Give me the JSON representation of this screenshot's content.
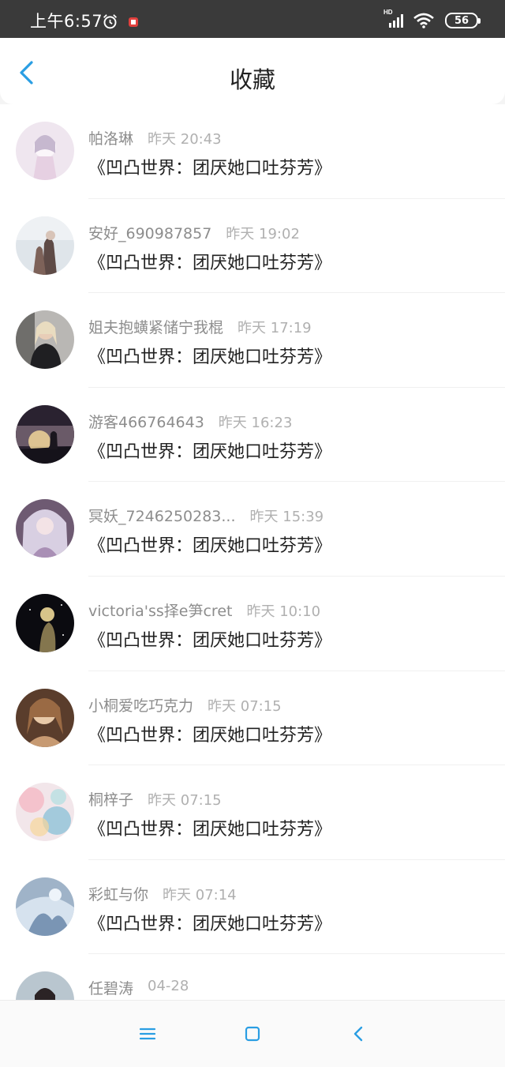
{
  "status_bar": {
    "time": "上午6:57",
    "network": "HD",
    "battery": "56",
    "icons": [
      "alarm-icon",
      "app-notification-icon",
      "signal-icon",
      "wifi-icon",
      "battery-icon"
    ]
  },
  "header": {
    "title": "收藏",
    "back_icon": "chevron-left-icon"
  },
  "favorites": [
    {
      "name": "帕洛琳",
      "time": "昨天 20:43",
      "content": "《凹凸世界：团厌她口吐芬芳》"
    },
    {
      "name": "安好_690987857",
      "time": "昨天 19:02",
      "content": "《凹凸世界：团厌她口吐芬芳》"
    },
    {
      "name": "姐夫抱蟥紧储宁我棍",
      "time": "昨天 17:19",
      "content": "《凹凸世界：团厌她口吐芬芳》"
    },
    {
      "name": "游客466764643",
      "time": "昨天 16:23",
      "content": "《凹凸世界：团厌她口吐芬芳》"
    },
    {
      "name": "冥妖_7246250283...",
      "time": "昨天 15:39",
      "content": "《凹凸世界：团厌她口吐芬芳》"
    },
    {
      "name": "victoria'ss择e笋cret",
      "time": "昨天 10:10",
      "content": "《凹凸世界：团厌她口吐芬芳》"
    },
    {
      "name": "小桐爱吃巧克力",
      "time": "昨天 07:15",
      "content": "《凹凸世界：团厌她口吐芬芳》"
    },
    {
      "name": "桐梓子",
      "time": "昨天 07:15",
      "content": "《凹凸世界：团厌她口吐芬芳》"
    },
    {
      "name": "彩虹与你",
      "time": "昨天 07:14",
      "content": "《凹凸世界：团厌她口吐芬芳》"
    },
    {
      "name": "任碧涛",
      "time": "04-28",
      "content": ""
    }
  ],
  "system_nav": {
    "menu_icon": "menu-icon",
    "home_icon": "home-square-icon",
    "back_icon": "back-triangle-icon"
  },
  "colors": {
    "accent": "#2a9ee3",
    "status_bar": "#3a3a3a",
    "name_text": "#8d8d8d",
    "time_text": "#b0b0b0"
  }
}
